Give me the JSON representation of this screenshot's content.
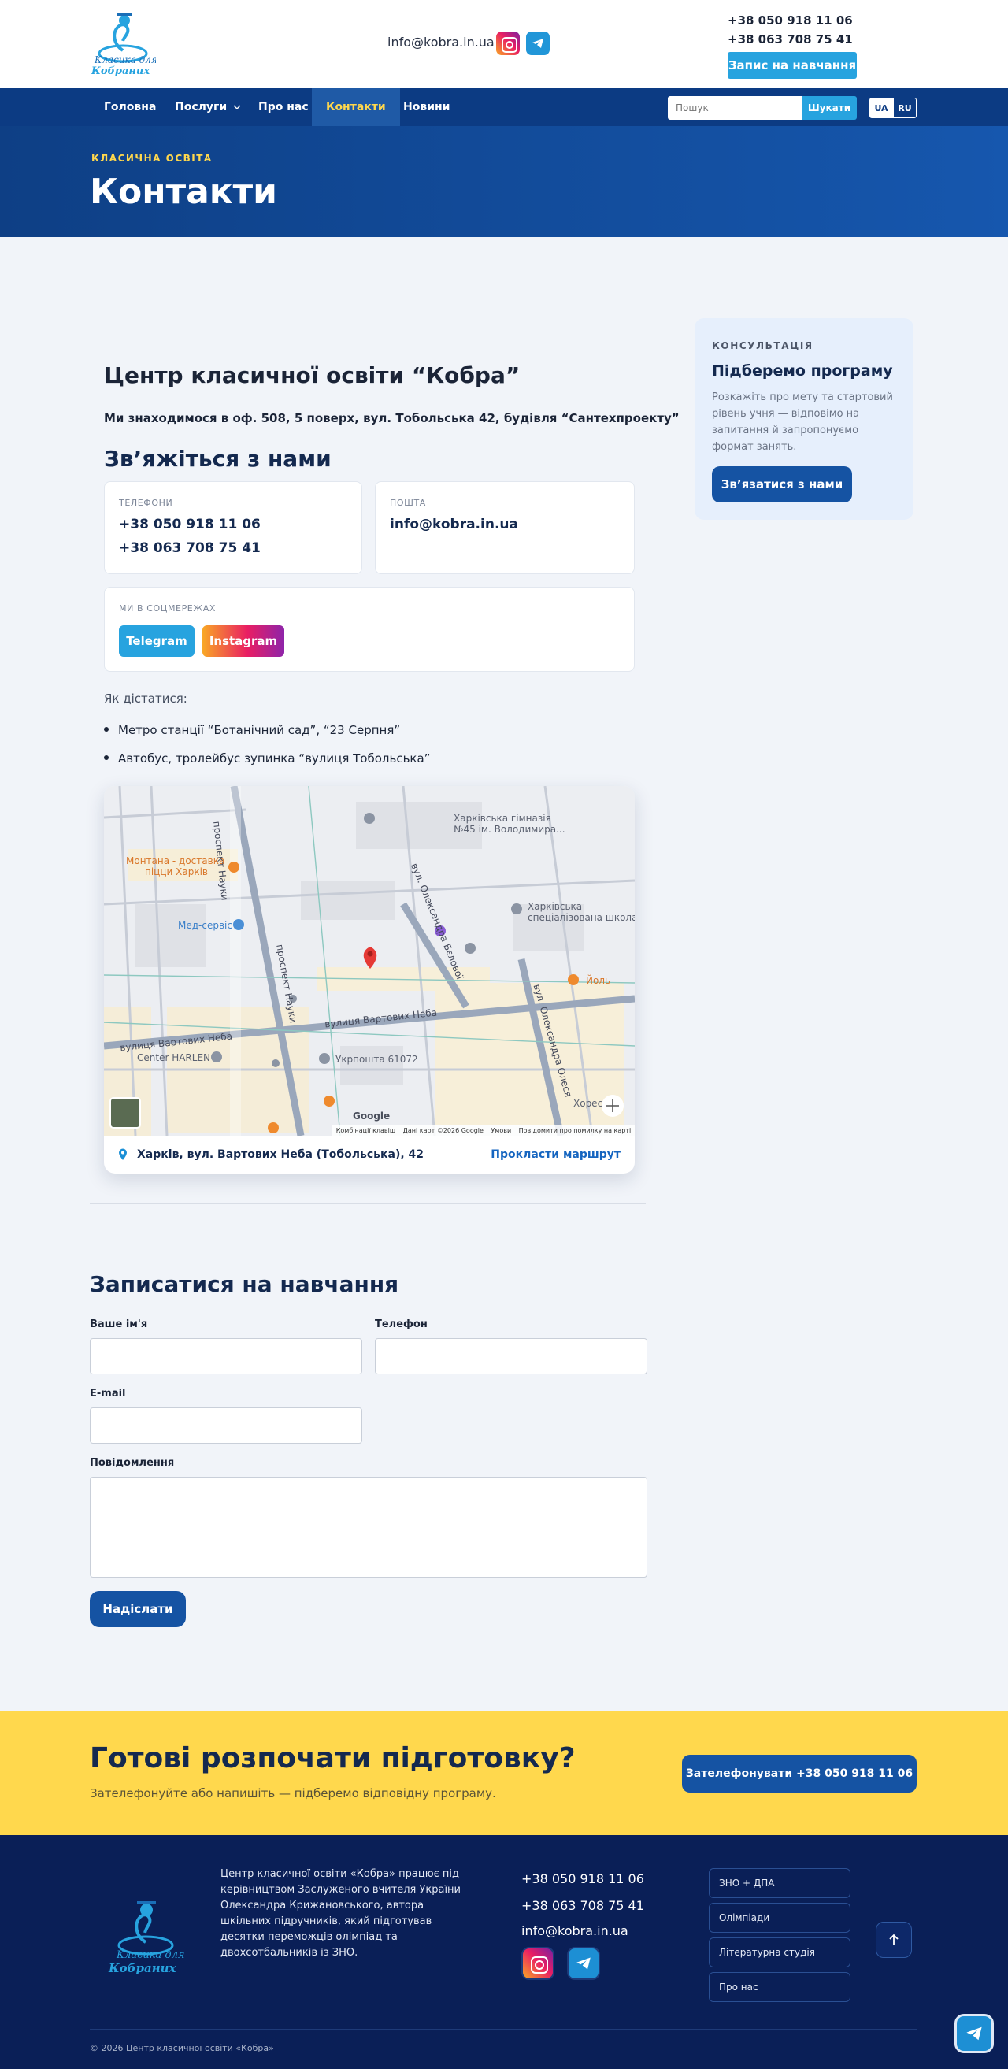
{
  "header": {
    "logo_line1": "Класика для",
    "logo_line2": "Кобраних",
    "email": "info@kobra.in.ua",
    "phones": [
      "+38 050 918 11 06",
      "+38 063 708 75 41"
    ],
    "cta": "Запис на навчання",
    "social": [
      "instagram-icon",
      "telegram-icon"
    ]
  },
  "nav": {
    "items": [
      {
        "label": "Головна"
      },
      {
        "label": "Послуги"
      },
      {
        "label": "Про нас"
      },
      {
        "label": "Контакти"
      },
      {
        "label": "Новини"
      }
    ],
    "active": "Контакти",
    "search_placeholder": "Пошук",
    "search_button": "Шукати",
    "langs": [
      "UA",
      "RU"
    ]
  },
  "hero": {
    "eyebrow": "КЛАСИЧНА ОСВІТА",
    "title": "Контакти"
  },
  "main": {
    "org_title": "Центр класичної освіти “Кобра”",
    "address": "Ми знаходимося в оф. 508, 5 поверх, вул. Тобольська 42, будівля “Сантехпроекту”",
    "contact_heading": "Зв’яжіться з нами",
    "phones_label": "ТЕЛЕФОНИ",
    "phones": [
      "+38 050 918 11 06",
      "+38 063 708 75 41"
    ],
    "mail_label": "ПОШТА",
    "mail": "info@kobra.in.ua",
    "social_label": "МИ В СОЦМЕРЕЖАХ",
    "telegram": "Telegram",
    "instagram": "Instagram",
    "howto": "Як дістатися:",
    "routes": [
      "Метро станції “Ботанічний сад”, “23 Серпня”",
      "Автобус, тролейбус зупинка “вулиця Тобольська”"
    ]
  },
  "map": {
    "labels": {
      "gym": "Харківська гімназія",
      "gym2": "№45 ім. Володимира...",
      "montana": "Монтана - доставка",
      "montana2": "піцци Харків",
      "med": "Мед-сервіс",
      "school": "Харківська",
      "school2": "спеціалізована школа...",
      "harlen": "Center HARLEN",
      "ukrposhta": "Укрпошта 61072",
      "yol": "Йоль",
      "khores": "Хорес",
      "street_nauky": "проспект Науки",
      "street_nauky2": "проспект Науки",
      "street_vartovykh": "вулиця Вартових Неба",
      "street_vartovykh2": "вулиця Вартових Неба",
      "street_beloi": "вул. Олександра Бєлової",
      "street_olesia": "вул. Олександра Олеся"
    },
    "google": "Google",
    "attribution": [
      "Комбінації клавіш",
      "Дані карт ©2026 Google",
      "Умови",
      "Повідомити про помилку на карті"
    ],
    "address": "Харків, вул. Вартових Неба (Тобольська), 42",
    "route": "Прокласти маршрут"
  },
  "sidebar": {
    "eyebrow": "КОНСУЛЬТАЦІЯ",
    "title": "Підберемо програму",
    "text": "Розкажіть про мету та стартовий рівень учня — відповімо на запитання й запропонуємо формат занять.",
    "button": "Зв’язатися з нами"
  },
  "form": {
    "heading": "Записатися на навчання",
    "name_label": "Ваше ім'я",
    "phone_label": "Телефон",
    "email_label": "E-mail",
    "message_label": "Повідомлення",
    "submit": "Надіслати"
  },
  "cta": {
    "title": "Готові розпочати підготовку?",
    "subtitle": "Зателефонуйте або напишіть — підберемо відповідну програму.",
    "button": "Зателефонувати +38 050 918 11 06"
  },
  "footer": {
    "logo_line1": "Класика для",
    "logo_line2": "Кобраних",
    "about": "Центр класичної освіти «Кобра» працює під керівництвом Заслуженого вчителя України Олександра Крижановського, автора шкільних підручників, який підготував десятки переможців олімпіад та двохсотбальників із ЗНО.",
    "phones": [
      "+38 050 918 11 06",
      "+38 063 708 75 41"
    ],
    "email": "info@kobra.in.ua",
    "links": [
      "ЗНО + ДПА",
      "Олімпіади",
      "Літературна студія",
      "Про нас"
    ],
    "copyright": "© 2026 Центр класичної освіти «Кобра»"
  },
  "colors": {
    "brand_blue": "#0c3b83",
    "accent_blue": "#27a3df",
    "yellow": "#ffd84d",
    "footer": "#0a1f57"
  }
}
